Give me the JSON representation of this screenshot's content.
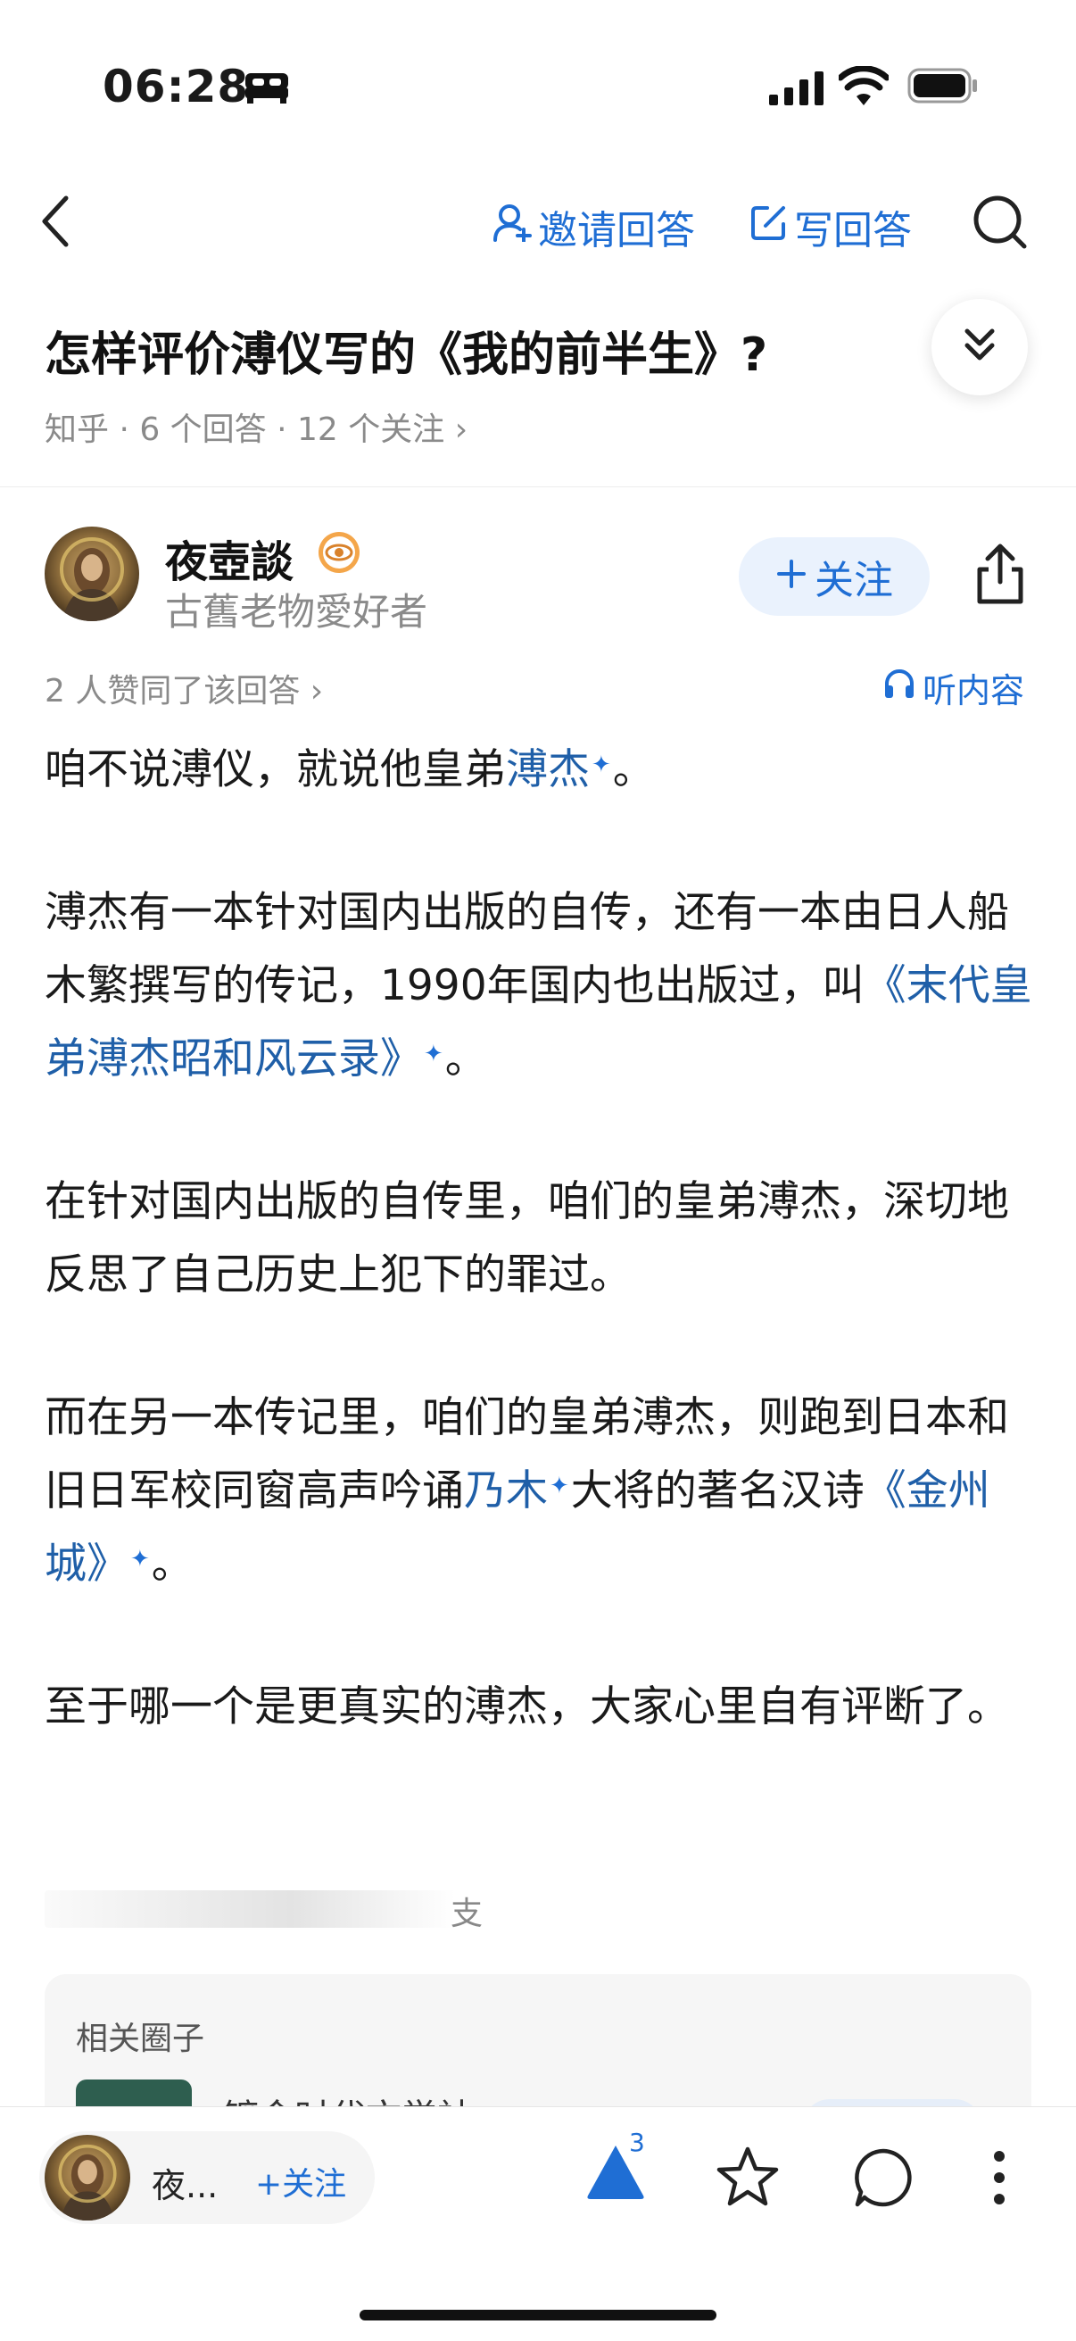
{
  "status_bar": {
    "time": "06:28"
  },
  "nav": {
    "invite_label": "邀请回答",
    "write_label": "写回答"
  },
  "question": {
    "title": "怎样评价溥仪写的《我的前半生》?",
    "meta": "知乎 · 6 个回答 · 12 个关注 ›"
  },
  "author": {
    "name": "夜壺談",
    "bio": "古舊老物愛好者",
    "follow_label": "关注",
    "short_name": "夜..."
  },
  "answer": {
    "likes": "2 人赞同了该回答 ›",
    "listen_label": "听内容",
    "p1": {
      "pre": "咱不说溥仪，就说他皇弟",
      "link": "溥杰",
      "post": "。"
    },
    "p2": {
      "pre": "溥杰有一本针对国内出版的自传，还有一本由日人船木繁撰写的传记，1990年国内也出版过，叫",
      "link": "《末代皇弟溥杰昭和风云录》",
      "post": "。"
    },
    "p3": "在针对国内出版的自传里，咱们的皇弟溥杰，深切地反思了自己历史上犯下的罪过。",
    "p4": {
      "pre": "而在另一本传记里，咱们的皇弟溥杰，则跑到日本和旧日军校同窗高声吟诵",
      "link1": "乃木",
      "mid": "大将的著名汉诗",
      "link2": "《金州城》",
      "post": "。"
    },
    "p5": "至于哪一个是更真实的溥杰，大家心里自有评断了。",
    "faded_char": "支"
  },
  "related": {
    "title": "相关圈子",
    "circle_name": "镀金时代文学社"
  },
  "bottom_bar": {
    "follow_label": "+关注",
    "upvote_count": "3"
  },
  "colors": {
    "accent": "#1f6ed4",
    "link": "#1f5fa8",
    "muted": "#8a8a8a"
  }
}
